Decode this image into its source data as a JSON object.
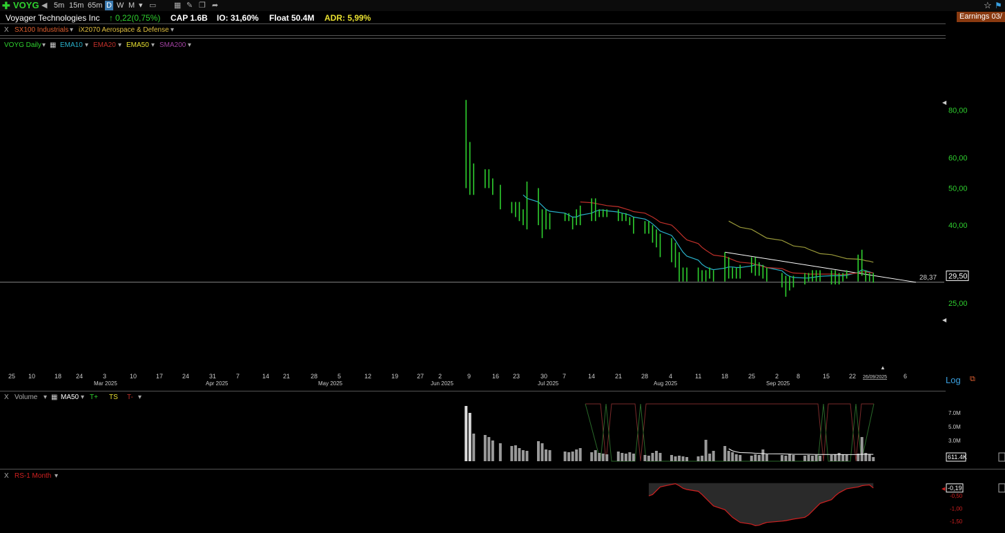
{
  "toolbar": {
    "symbol": "VOYG",
    "intervals": [
      "5m",
      "15m",
      "65m",
      "D",
      "W",
      "M"
    ],
    "active_interval": "D"
  },
  "header": {
    "company": "Voyager Technologies Inc",
    "change": "0,22(0,75%)",
    "cap": "CAP 1.6B",
    "io": "IO: 31,60%",
    "float": "Float 50.4M",
    "adr": "ADR: 5,99%",
    "earnings": "Earnings 03/"
  },
  "groups": {
    "close": "X",
    "sector": "SX100 Industrials",
    "industry": "iX2070 Aerospace & Defense"
  },
  "price_legend": {
    "series": "VOYG Daily",
    "ema10": "EMA10",
    "ema20": "EMA20",
    "ema50": "EMA50",
    "sma200": "SMA200"
  },
  "volume_legend": {
    "close": "X",
    "title": "Volume",
    "ma": "MA50",
    "t_plus": "T+",
    "ts": "TS",
    "t_minus": "T-"
  },
  "rs_legend": {
    "close": "X",
    "title": "RS-1 Month"
  },
  "scale_toggle": "Log",
  "colors": {
    "up_bar": "#2fd12f",
    "ema10": "#29b0c9",
    "ema20": "#c0302a",
    "ema50": "#9a9a3a",
    "sma200": "#a040a0",
    "price_label": "#2fd12f",
    "volume": "#9a9a9a",
    "rs_line": "#d02020"
  },
  "chart_data": [
    {
      "type": "bar",
      "title": "VOYG Daily",
      "scale": "log",
      "y_ticks": [
        "80,00",
        "60,00",
        "50,00",
        "40,00",
        "25,00"
      ],
      "y_tick_values": [
        80,
        60,
        50,
        40,
        25
      ],
      "ylim": [
        22,
        95
      ],
      "last_price_label": "29,50",
      "level_label": "28,37",
      "level_value": 28.37,
      "x_labels": [
        "25",
        "10",
        "18",
        "24",
        "3",
        "10",
        "17",
        "24",
        "31",
        "7",
        "14",
        "21",
        "28",
        "5",
        "12",
        "19",
        "27",
        "2",
        "9",
        "16",
        "23",
        "30",
        "7",
        "14",
        "21",
        "28",
        "4",
        "11",
        "18",
        "25",
        "2",
        "8",
        "15",
        "22",
        "26/09/2025",
        "6"
      ],
      "month_labels": [
        "Mar 2025",
        "Apr 2025",
        "May 2025",
        "Jun 2025",
        "Jul 2025",
        "Aug 2025",
        "Sep 2025"
      ],
      "dates": [
        "2025-06-11",
        "2025-06-12",
        "2025-06-13",
        "2025-06-16",
        "2025-06-17",
        "2025-06-18",
        "2025-06-20",
        "2025-06-23",
        "2025-06-24",
        "2025-06-25",
        "2025-06-26",
        "2025-06-27",
        "2025-06-30",
        "2025-07-01",
        "2025-07-02",
        "2025-07-03",
        "2025-07-07",
        "2025-07-08",
        "2025-07-09",
        "2025-07-10",
        "2025-07-11",
        "2025-07-14",
        "2025-07-15",
        "2025-07-16",
        "2025-07-17",
        "2025-07-18",
        "2025-07-21",
        "2025-07-22",
        "2025-07-23",
        "2025-07-24",
        "2025-07-25",
        "2025-07-28",
        "2025-07-29",
        "2025-07-30",
        "2025-07-31",
        "2025-08-01",
        "2025-08-04",
        "2025-08-05",
        "2025-08-06",
        "2025-08-07",
        "2025-08-08",
        "2025-08-11",
        "2025-08-12",
        "2025-08-13",
        "2025-08-14",
        "2025-08-15",
        "2025-08-18",
        "2025-08-19",
        "2025-08-20",
        "2025-08-21",
        "2025-08-22",
        "2025-08-25",
        "2025-08-26",
        "2025-08-27",
        "2025-08-28",
        "2025-08-29",
        "2025-09-02",
        "2025-09-03",
        "2025-09-04",
        "2025-09-05",
        "2025-09-08",
        "2025-09-09",
        "2025-09-10",
        "2025-09-11",
        "2025-09-12",
        "2025-09-15",
        "2025-09-16",
        "2025-09-17",
        "2025-09-18",
        "2025-09-19",
        "2025-09-22",
        "2025-09-23",
        "2025-09-24",
        "2025-09-25",
        "2025-09-26"
      ],
      "high": [
        85,
        66,
        58,
        56,
        56,
        53,
        51,
        46,
        46,
        46,
        44,
        52,
        50,
        44,
        44,
        43,
        43,
        43,
        42,
        44,
        45,
        47,
        47,
        44,
        44,
        44,
        44,
        43,
        43,
        42,
        42,
        41,
        41,
        40,
        39,
        38,
        37,
        36,
        34,
        31,
        31,
        31,
        30.5,
        30.5,
        31,
        30.5,
        34,
        33,
        31,
        31,
        31.5,
        33,
        33,
        32,
        31.5,
        31,
        30,
        29.5,
        29.5,
        29.5,
        30,
        30,
        30.5,
        30.5,
        30.5,
        30.5,
        30.5,
        30,
        30,
        30.5,
        33.5,
        34.5,
        30.5,
        30,
        30
      ],
      "low": [
        50,
        48,
        48,
        50,
        50,
        48,
        44,
        43,
        42,
        41,
        40,
        39,
        40,
        37,
        39,
        39,
        41,
        41,
        39,
        40,
        40,
        41,
        41,
        42,
        42,
        42,
        41,
        41,
        41,
        40,
        38,
        38,
        38,
        36,
        35,
        33,
        32,
        31,
        28.5,
        28.5,
        28.5,
        28.5,
        28.5,
        28.5,
        29,
        28.5,
        28.5,
        29,
        29,
        29,
        29,
        30,
        29.5,
        29.5,
        29,
        28.5,
        27.5,
        26,
        27,
        27.5,
        28,
        28.5,
        28.5,
        28.5,
        28.5,
        28,
        28,
        28,
        28.5,
        29,
        28.5,
        29.5,
        28.5,
        28.5,
        28.3
      ],
      "series": [
        {
          "name": "EMA10",
          "values": [
            null,
            null,
            null,
            null,
            null,
            null,
            null,
            null,
            null,
            null,
            48,
            47,
            46,
            45,
            44,
            43.5,
            43,
            42.5,
            42,
            42,
            42.5,
            43,
            43.5,
            43.8,
            43.8,
            43.6,
            43.3,
            43,
            42.8,
            42.5,
            42,
            41.5,
            41,
            40.3,
            39.5,
            38.6,
            37.6,
            36.5,
            35.2,
            34,
            33.2,
            32.4,
            31.6,
            31.1,
            30.8,
            30.6,
            30.9,
            31.1,
            31.1,
            31,
            31,
            31.3,
            31.5,
            31.5,
            31.3,
            31,
            30.4,
            29.8,
            29.4,
            29.2,
            29.1,
            29.1,
            29.2,
            29.3,
            29.4,
            29.5,
            29.5,
            29.5,
            29.5,
            29.6,
            30.1,
            30.6,
            30.4,
            30.2,
            30
          ]
        },
        {
          "name": "EMA20",
          "values": [
            null,
            null,
            null,
            null,
            null,
            null,
            null,
            null,
            null,
            null,
            null,
            null,
            null,
            null,
            null,
            null,
            null,
            null,
            null,
            null,
            46,
            45.8,
            45.6,
            45.4,
            45.2,
            45,
            44.7,
            44.4,
            44.1,
            43.8,
            43.4,
            43,
            42.5,
            42,
            41.4,
            40.7,
            40,
            39.2,
            38.3,
            37.4,
            36.6,
            35.8,
            35,
            34.4,
            33.9,
            33.4,
            33.1,
            32.8,
            32.5,
            32.2,
            32,
            31.8,
            31.6,
            31.4,
            31.2,
            31,
            30.8,
            30.5,
            30.2,
            30,
            29.9,
            29.8,
            29.8,
            29.8,
            29.8,
            29.8,
            29.8,
            29.7,
            29.7,
            29.8,
            30,
            30.2,
            30.2,
            30.1,
            30
          ]
        },
        {
          "name": "EMA50",
          "values": [
            null,
            null,
            null,
            null,
            null,
            null,
            null,
            null,
            null,
            null,
            null,
            null,
            null,
            null,
            null,
            null,
            null,
            null,
            null,
            null,
            null,
            null,
            null,
            null,
            null,
            null,
            null,
            null,
            null,
            null,
            null,
            null,
            null,
            null,
            null,
            null,
            null,
            null,
            null,
            null,
            null,
            null,
            null,
            null,
            null,
            null,
            null,
            41,
            40.5,
            40,
            39.5,
            39,
            38.5,
            38,
            37.5,
            37,
            36.5,
            36.1,
            35.7,
            35.3,
            35,
            34.6,
            34.3,
            34,
            33.7,
            33.5,
            33.3,
            33.1,
            32.9,
            32.7,
            32.6,
            32.5,
            32.3,
            32.2,
            32
          ]
        }
      ]
    },
    {
      "type": "bar",
      "title": "Volume",
      "y_ticks": [
        "7.0M",
        "5.0M",
        "3.0M"
      ],
      "y_tick_values": [
        7,
        5,
        3
      ],
      "ylim": [
        0,
        8
      ],
      "last_value_label": "611.4K",
      "values": [
        8,
        7,
        4,
        3.8,
        3.5,
        3,
        2.6,
        2.2,
        2.3,
        1.9,
        1.6,
        1.5,
        2.9,
        2.6,
        1.7,
        1.6,
        1.4,
        1.3,
        1.4,
        1.7,
        1.9,
        1.3,
        1.6,
        1.2,
        1.1,
        1.0,
        1.4,
        1.2,
        1.1,
        1.3,
        1.1,
        0.9,
        0.8,
        1.2,
        1.5,
        1.2,
        0.9,
        0.7,
        0.8,
        0.7,
        0.6,
        0.7,
        0.8,
        3.1,
        1.1,
        1.5,
        2.2,
        1.5,
        1.3,
        1.0,
        0.9,
        0.8,
        1.0,
        0.9,
        1.7,
        1.0,
        0.9,
        0.8,
        1.0,
        0.9,
        0.8,
        0.9,
        0.8,
        0.9,
        0.8,
        0.9,
        1.0,
        1.2,
        1.0,
        0.9,
        1.1,
        3.5,
        1.2,
        1.0,
        0.6
      ],
      "series": [
        {
          "name": "MA50",
          "values": [
            null,
            null,
            null,
            null,
            null,
            null,
            null,
            null,
            null,
            null,
            null,
            null,
            null,
            null,
            null,
            null,
            null,
            null,
            null,
            null,
            null,
            null,
            null,
            null,
            null,
            null,
            null,
            null,
            null,
            null,
            null,
            null,
            null,
            null,
            null,
            null,
            null,
            null,
            null,
            null,
            null,
            null,
            null,
            null,
            null,
            null,
            null,
            1.8,
            1.5,
            1.35,
            1.25,
            1.2,
            1.15,
            1.12,
            1.1,
            1.08,
            1.06,
            1.04,
            1.02,
            1.0,
            1.0,
            1.0,
            0.99,
            0.98,
            0.98,
            0.97,
            0.97,
            0.97,
            0.96,
            0.96,
            0.97,
            1.0,
            1.0,
            1.0,
            0.99
          ]
        }
      ]
    },
    {
      "type": "area",
      "title": "RS-1 Month",
      "y_ticks": [
        "-0,50",
        "-1,00",
        "-1,50"
      ],
      "y_tick_values": [
        -0.5,
        -1,
        -1.5
      ],
      "ylim": [
        -1.75,
        0.05
      ],
      "last_value_label": "-0,19",
      "values": [
        null,
        null,
        null,
        null,
        null,
        null,
        null,
        null,
        null,
        null,
        null,
        null,
        null,
        null,
        null,
        null,
        null,
        null,
        null,
        null,
        null,
        null,
        null,
        null,
        null,
        null,
        null,
        null,
        null,
        null,
        null,
        null,
        -0.5,
        -0.45,
        -0.3,
        -0.15,
        -0.05,
        -0.02,
        -0.1,
        -0.2,
        -0.25,
        -0.32,
        -0.45,
        -0.6,
        -0.75,
        -0.9,
        -1.05,
        -1.2,
        -1.35,
        -1.45,
        -1.55,
        -1.62,
        -1.68,
        -1.66,
        -1.6,
        -1.55,
        -1.5,
        -1.48,
        -1.45,
        -1.42,
        -1.35,
        -1.25,
        -1.1,
        -0.95,
        -0.8,
        -0.65,
        -0.5,
        -0.38,
        -0.3,
        -0.22,
        -0.15,
        -0.1,
        -0.08,
        -0.07,
        -0.19
      ]
    }
  ]
}
